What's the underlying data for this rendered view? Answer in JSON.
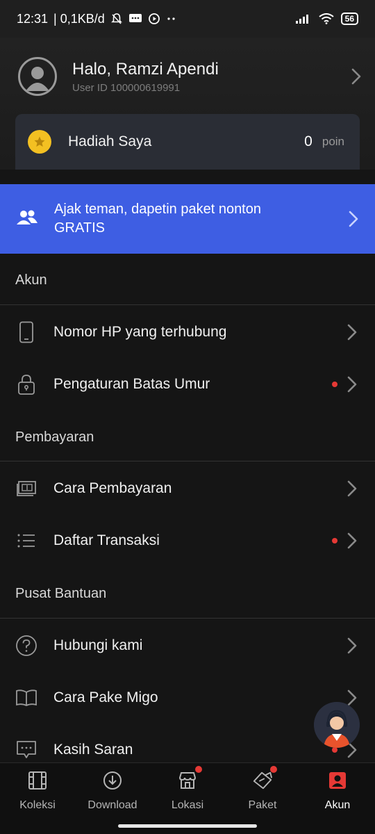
{
  "status_bar": {
    "time": "12:31",
    "network_speed": "| 0,1KB/d",
    "battery": "56"
  },
  "profile": {
    "greeting": "Halo, Ramzi Apendi",
    "user_id": "User ID 100000619991"
  },
  "rewards": {
    "label": "Hadiah Saya",
    "points": "0",
    "unit": "poin"
  },
  "invite": {
    "text": "Ajak teman, dapetin paket nonton GRATIS"
  },
  "sections": {
    "akun": {
      "title": "Akun",
      "items": [
        {
          "label": "Nomor HP yang terhubung",
          "icon": "phone-icon"
        },
        {
          "label": "Pengaturan Batas Umur",
          "icon": "lock-icon",
          "dot": true
        }
      ]
    },
    "pembayaran": {
      "title": "Pembayaran",
      "items": [
        {
          "label": "Cara Pembayaran",
          "icon": "payment-icon"
        },
        {
          "label": "Daftar Transaksi",
          "icon": "list-icon",
          "dot": true
        }
      ]
    },
    "bantuan": {
      "title": "Pusat Bantuan",
      "items": [
        {
          "label": "Hubungi kami",
          "icon": "help-icon"
        },
        {
          "label": "Cara Pake Migo",
          "icon": "book-icon"
        },
        {
          "label": "Kasih Saran",
          "icon": "chat-icon",
          "dot": true
        }
      ]
    }
  },
  "bottom_nav": [
    {
      "label": "Koleksi",
      "icon": "film-icon"
    },
    {
      "label": "Download",
      "icon": "download-icon"
    },
    {
      "label": "Lokasi",
      "icon": "store-icon",
      "dot": true
    },
    {
      "label": "Paket",
      "icon": "ticket-icon",
      "dot": true
    },
    {
      "label": "Akun",
      "icon": "account-icon",
      "active": true
    }
  ],
  "colors": {
    "background": "#151515",
    "banner": "#3e5ee3",
    "accent_red": "#e53935",
    "coin": "#f3c022"
  }
}
